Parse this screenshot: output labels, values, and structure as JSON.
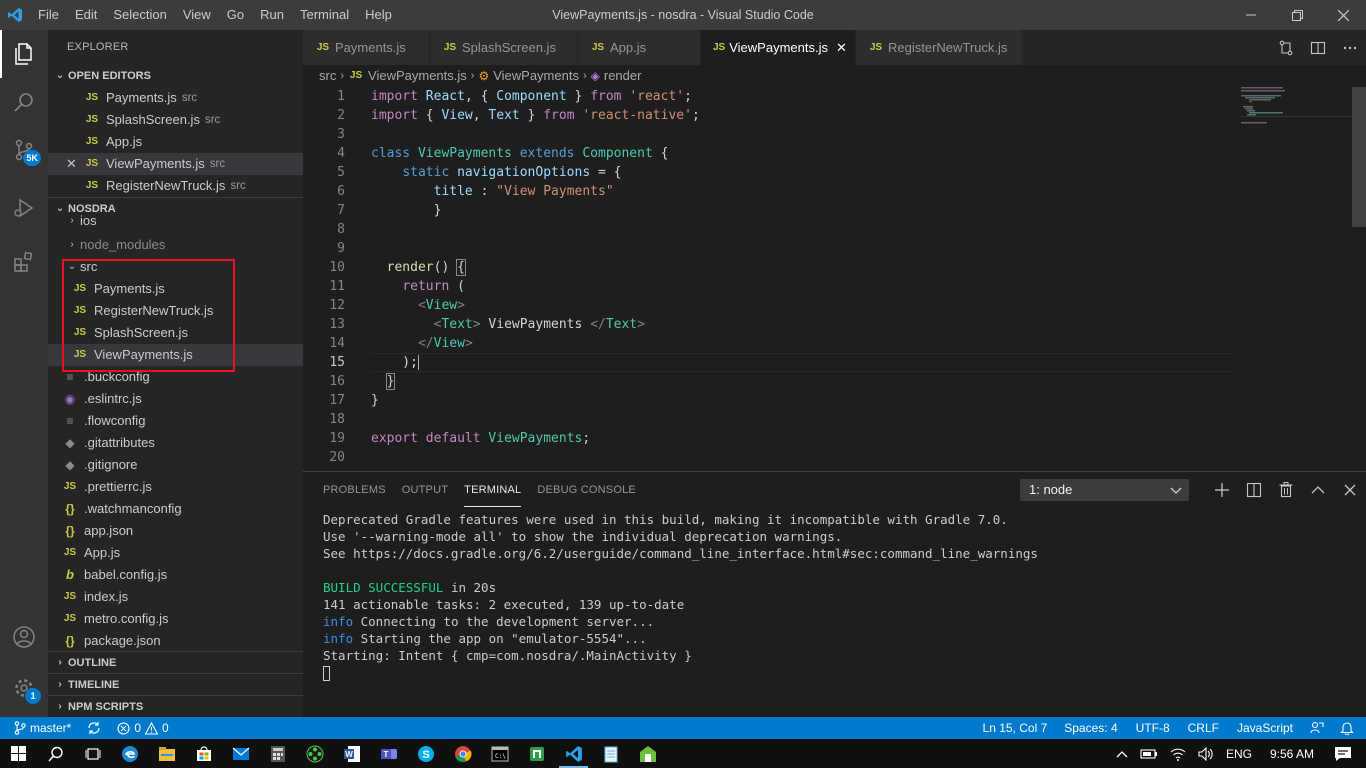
{
  "window": {
    "title": "ViewPayments.js - nosdra - Visual Studio Code",
    "menu": [
      "File",
      "Edit",
      "Selection",
      "View",
      "Go",
      "Run",
      "Terminal",
      "Help"
    ]
  },
  "activity": {
    "source_control_badge": "5K",
    "settings_badge": "1"
  },
  "sidebar": {
    "header": "EXPLORER",
    "open_editors_label": "OPEN EDITORS",
    "open_editors": [
      {
        "name": "Payments.js",
        "desc": "src"
      },
      {
        "name": "SplashScreen.js",
        "desc": "src"
      },
      {
        "name": "App.js",
        "desc": ""
      },
      {
        "name": "ViewPayments.js",
        "desc": "src"
      },
      {
        "name": "RegisterNewTruck.js",
        "desc": "src"
      }
    ],
    "project_label": "NOSDRA",
    "tree": {
      "ios": "ios",
      "node_modules": "node_modules",
      "src": "src",
      "src_files": [
        "Payments.js",
        "RegisterNewTruck.js",
        "SplashScreen.js",
        "ViewPayments.js"
      ],
      "root_files": [
        ".buckconfig",
        ".eslintrc.js",
        ".flowconfig",
        ".gitattributes",
        ".gitignore",
        ".prettierrc.js",
        ".watchmanconfig",
        "app.json",
        "App.js",
        "babel.config.js",
        "index.js",
        "metro.config.js",
        "package.json"
      ]
    },
    "outline_label": "OUTLINE",
    "timeline_label": "TIMELINE",
    "npm_label": "NPM SCRIPTS"
  },
  "tabs": [
    "Payments.js",
    "SplashScreen.js",
    "App.js",
    "ViewPayments.js",
    "RegisterNewTruck.js"
  ],
  "breadcrumb": {
    "folder": "src",
    "file": "ViewPayments.js",
    "class": "ViewPayments",
    "method": "render"
  },
  "editor": {
    "line_numbers": [
      "1",
      "2",
      "3",
      "4",
      "5",
      "6",
      "7",
      "8",
      "9",
      "10",
      "11",
      "12",
      "13",
      "14",
      "15",
      "16",
      "17",
      "18",
      "19",
      "20"
    ]
  },
  "panel": {
    "tabs": [
      "PROBLEMS",
      "OUTPUT",
      "TERMINAL",
      "DEBUG CONSOLE"
    ],
    "terminal_select": "1: node",
    "lines": {
      "l1": "Deprecated Gradle features were used in this build, making it incompatible with Gradle 7.0.",
      "l2": "Use '--warning-mode all' to show the individual deprecation warnings.",
      "l3": "See https://docs.gradle.org/6.2/userguide/command_line_interface.html#sec:command_line_warnings",
      "l5a": "BUILD SUCCESSFUL",
      "l5b": " in 20s",
      "l6": "141 actionable tasks: 2 executed, 139 up-to-date",
      "l7a": "info",
      "l7b": " Connecting to the development server...",
      "l8a": "info",
      "l8b": " Starting the app on \"emulator-5554\"...",
      "l9": "Starting: Intent { cmp=com.nosdra/.MainActivity }"
    }
  },
  "status": {
    "branch": "master*",
    "errors": "0",
    "warnings": "0",
    "position": "Ln 15, Col 7",
    "spaces": "Spaces: 4",
    "encoding": "UTF-8",
    "eol": "CRLF",
    "language": "JavaScript"
  },
  "taskbar": {
    "language": "ENG",
    "time": "9:56 AM"
  },
  "colors": {
    "accent": "#007acc",
    "highlight_box": "#e81123"
  }
}
